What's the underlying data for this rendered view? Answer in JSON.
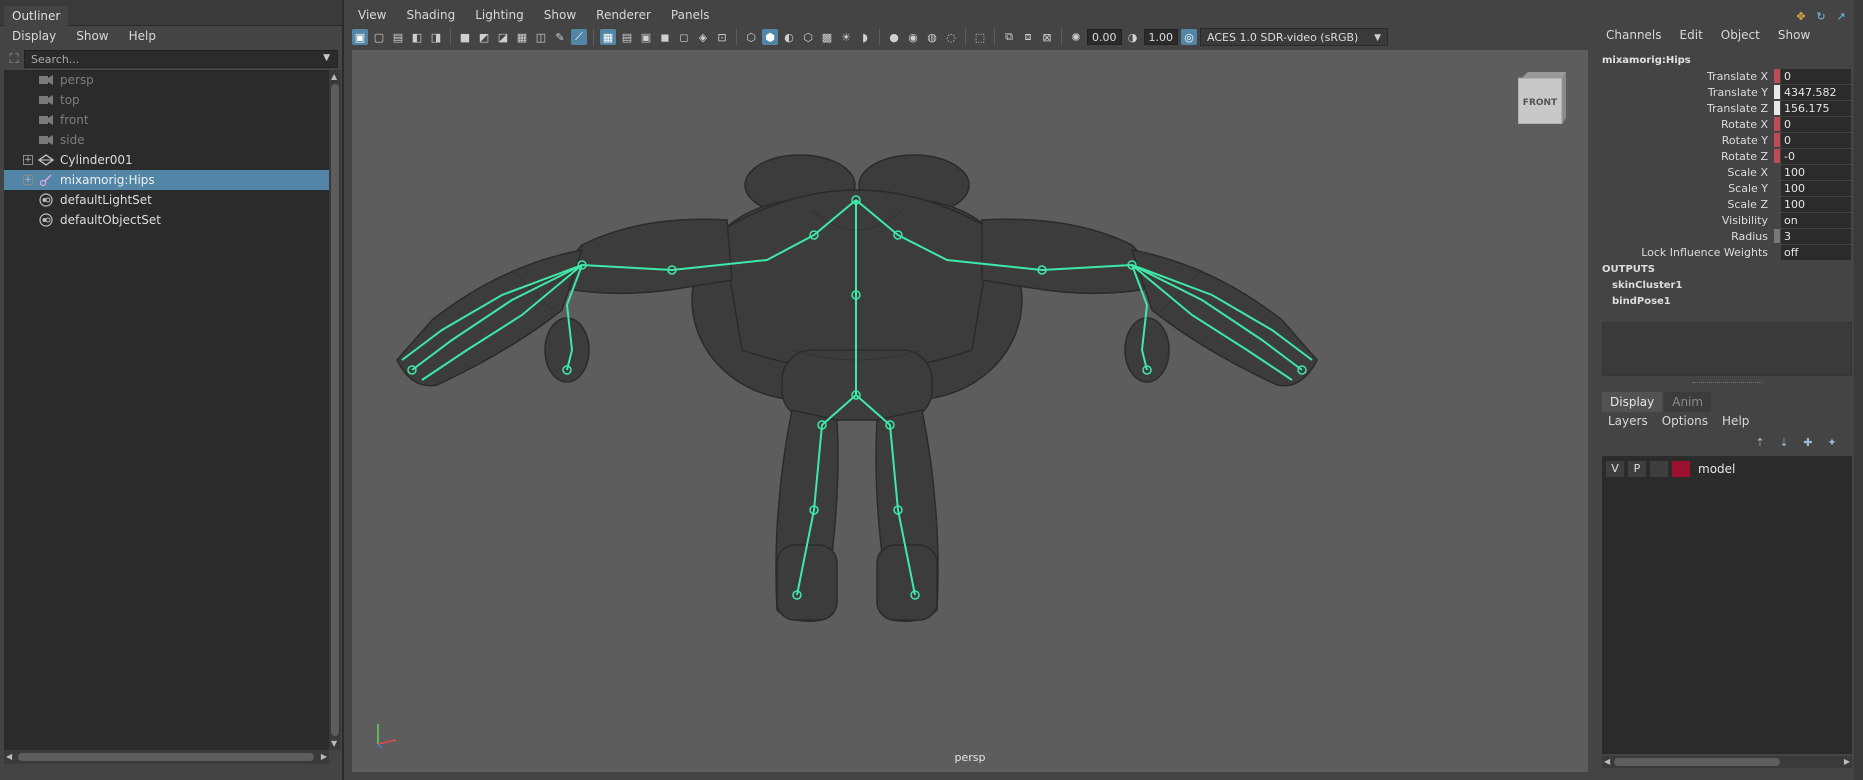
{
  "outliner": {
    "tab_label": "Outliner",
    "menu": [
      "Display",
      "Show",
      "Help"
    ],
    "search_placeholder": "Search...",
    "items": [
      {
        "label": "persp",
        "icon": "camera-icon",
        "dim": true
      },
      {
        "label": "top",
        "icon": "camera-icon",
        "dim": true
      },
      {
        "label": "front",
        "icon": "camera-icon",
        "dim": true
      },
      {
        "label": "side",
        "icon": "camera-icon",
        "dim": true
      },
      {
        "label": "Cylinder001",
        "icon": "mesh-icon",
        "dim": false,
        "expandable": true
      },
      {
        "label": "mixamorig:Hips",
        "icon": "joint-icon",
        "dim": false,
        "expandable": true,
        "selected": true
      },
      {
        "label": "defaultLightSet",
        "icon": "set-icon",
        "dim": false
      },
      {
        "label": "defaultObjectSet",
        "icon": "set-icon",
        "dim": false
      }
    ]
  },
  "viewport": {
    "menu": [
      "View",
      "Shading",
      "Lighting",
      "Show",
      "Renderer",
      "Panels"
    ],
    "exposure": "0.00",
    "gamma": "1.00",
    "colorspace": "ACES 1.0 SDR-video (sRGB)",
    "view_cube_label": "FRONT",
    "camera_label": "persp",
    "colors": {
      "joint": "#3ee8a8",
      "canvas": "#5d5d5d",
      "mesh": "#3c3c3c"
    }
  },
  "channelbox": {
    "menu": [
      "Channels",
      "Edit",
      "Object",
      "Show"
    ],
    "object_name": "mixamorig:Hips",
    "channels": [
      {
        "label": "Translate X",
        "value": "0",
        "key": "red"
      },
      {
        "label": "Translate Y",
        "value": "4347.582",
        "key": "light"
      },
      {
        "label": "Translate Z",
        "value": "156.175",
        "key": "light"
      },
      {
        "label": "Rotate X",
        "value": "0",
        "key": "red"
      },
      {
        "label": "Rotate Y",
        "value": "0",
        "key": "red"
      },
      {
        "label": "Rotate Z",
        "value": "-0",
        "key": "red"
      },
      {
        "label": "Scale X",
        "value": "100",
        "key": "none"
      },
      {
        "label": "Scale Y",
        "value": "100",
        "key": "none"
      },
      {
        "label": "Scale Z",
        "value": "100",
        "key": "none"
      },
      {
        "label": "Visibility",
        "value": "on",
        "key": "none"
      },
      {
        "label": "Radius",
        "value": "3",
        "key": "grey"
      },
      {
        "label": "Lock Influence Weights",
        "value": "off",
        "key": "none"
      }
    ],
    "outputs_title": "OUTPUTS",
    "outputs": [
      "skinCluster1",
      "bindPose1"
    ],
    "layer_tabs": [
      {
        "label": "Display",
        "active": true
      },
      {
        "label": "Anim",
        "active": false
      }
    ],
    "layer_menu": [
      "Layers",
      "Options",
      "Help"
    ],
    "layer": {
      "visible_flag": "V",
      "playback_flag": "P",
      "name": "model",
      "color": "#9b1230"
    }
  }
}
